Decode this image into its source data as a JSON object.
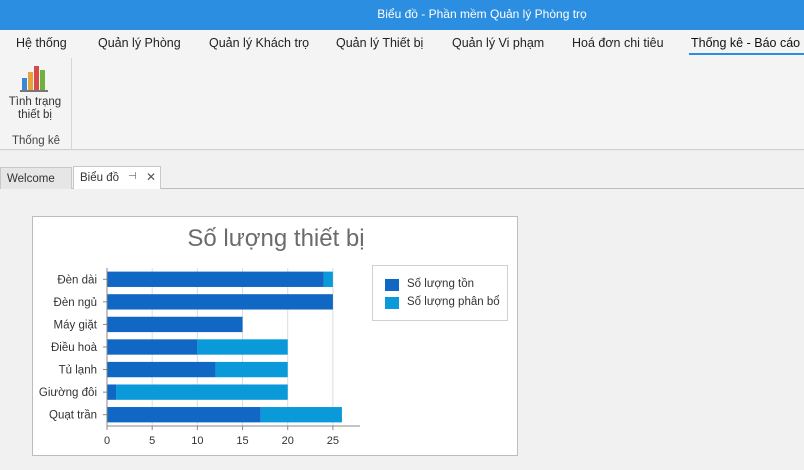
{
  "window": {
    "title": "Biểu đồ - Phần mềm Quản lý Phòng trọ"
  },
  "menu": {
    "tabs": [
      {
        "label": "Hệ thống"
      },
      {
        "label": "Quản lý Phòng"
      },
      {
        "label": "Quản lý Khách trọ"
      },
      {
        "label": "Quản lý Thiết bị"
      },
      {
        "label": "Quản lý Vi phạm"
      },
      {
        "label": "Hoá đơn chi tiêu"
      },
      {
        "label": "Thống kê - Báo cáo"
      }
    ],
    "active_index": 6
  },
  "ribbon": {
    "button": {
      "label_line1": "Tình trạng",
      "label_line2": "thiết bị",
      "icon": "bar-chart-icon"
    },
    "group_label": "Thống kê"
  },
  "doc_tabs": [
    {
      "label": "Welcome"
    },
    {
      "label": "Biểu đồ",
      "active": true,
      "pin_icon": "pin-icon",
      "close_icon": "close-icon"
    }
  ],
  "glyphs": {
    "pin": "⊣",
    "close": "✕"
  },
  "colors": {
    "series1": "#1067c4",
    "series2": "#0a99d9",
    "titlebar": "#2b8ee0"
  },
  "chart_data": {
    "type": "bar",
    "orientation": "horizontal",
    "stacked": true,
    "title": "Số lượng thiết bị",
    "categories": [
      "Đèn dài",
      "Đèn ngủ",
      "Máy giặt",
      "Điều hoà",
      "Tủ lạnh",
      "Giường đôi",
      "Quạt trần"
    ],
    "series": [
      {
        "name": "Số lượng tồn",
        "values": [
          24,
          25,
          15,
          10,
          12,
          1,
          17
        ]
      },
      {
        "name": "Số lượng phân bổ",
        "values": [
          1,
          0,
          0,
          10,
          8,
          19,
          9
        ]
      }
    ],
    "xlim": [
      0,
      28
    ],
    "xticks": [
      0,
      5,
      10,
      15,
      20,
      25
    ],
    "grid": true,
    "legend_position": "right"
  }
}
